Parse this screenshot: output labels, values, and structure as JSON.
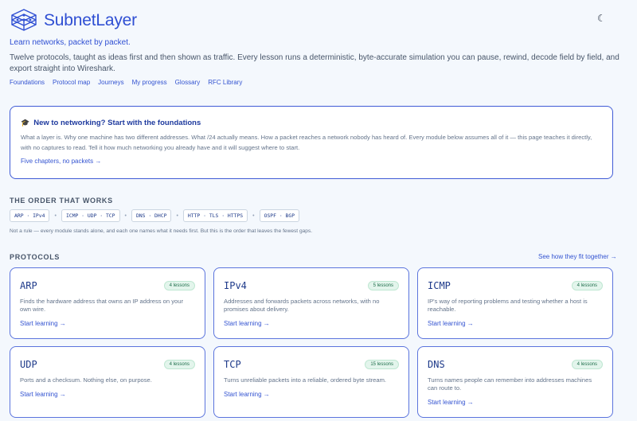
{
  "brand": {
    "name": "SubnetLayer",
    "logo_icon": "network-cube-icon"
  },
  "theme_toggle": {
    "icon": "moon-icon",
    "glyph": "☾"
  },
  "tagline": "Learn networks, packet by packet.",
  "intro": "Twelve protocols, taught as ideas first and then shown as traffic. Every lesson runs a deterministic, byte-accurate simulation you can pause, rewind, decode field by field, and export straight into Wireshark.",
  "nav": [
    "Foundations",
    "Protocol map",
    "Journeys",
    "My progress",
    "Glossary",
    "RFC Library"
  ],
  "callout": {
    "icon": "graduation-cap-icon",
    "icon_glyph": "🎓",
    "title": "New to networking? Start with the foundations",
    "body": "What a layer is. Why one machine has two different addresses. What /24 actually means. How a packet reaches a network nobody has heard of. Every module below assumes all of it — this page teaches it directly, with no captures to read. Tell it how much networking you already have and it will suggest where to start.",
    "link": "Five chapters, no packets →"
  },
  "order": {
    "heading": "THE ORDER THAT WORKS",
    "steps": [
      "ARP · IPv4",
      "ICMP · UDP · TCP",
      "DNS · DHCP",
      "HTTP · TLS · HTTPS",
      "OSPF · BGP"
    ],
    "separator": "•",
    "note": "Not a rule — every module stands alone, and each one names what it needs first. But this is the order that leaves the fewest gaps."
  },
  "protocols": {
    "heading": "PROTOCOLS",
    "see_fit": "See how they fit together →",
    "cards": [
      {
        "name": "ARP",
        "lessons": "4 lessons",
        "desc": "Finds the hardware address that owns an IP address on your own wire.",
        "link": "Start learning →"
      },
      {
        "name": "IPv4",
        "lessons": "5 lessons",
        "desc": "Addresses and forwards packets across networks, with no promises about delivery.",
        "link": "Start learning →"
      },
      {
        "name": "ICMP",
        "lessons": "4 lessons",
        "desc": "IP's way of reporting problems and testing whether a host is reachable.",
        "link": "Start learning →"
      },
      {
        "name": "UDP",
        "lessons": "4 lessons",
        "desc": "Ports and a checksum. Nothing else, on purpose.",
        "link": "Start learning →"
      },
      {
        "name": "TCP",
        "lessons": "15 lessons",
        "desc": "Turns unreliable packets into a reliable, ordered byte stream.",
        "link": "Start learning →"
      },
      {
        "name": "DNS",
        "lessons": "4 lessons",
        "desc": "Turns names people can remember into addresses machines can route to.",
        "link": "Start learning →"
      }
    ]
  },
  "colors": {
    "accent": "#2f4fd3",
    "card_border": "#5b74dd",
    "badge_bg": "#e3f5ec",
    "badge_text": "#1f6e4c",
    "page_bg": "#f4f8fd"
  }
}
